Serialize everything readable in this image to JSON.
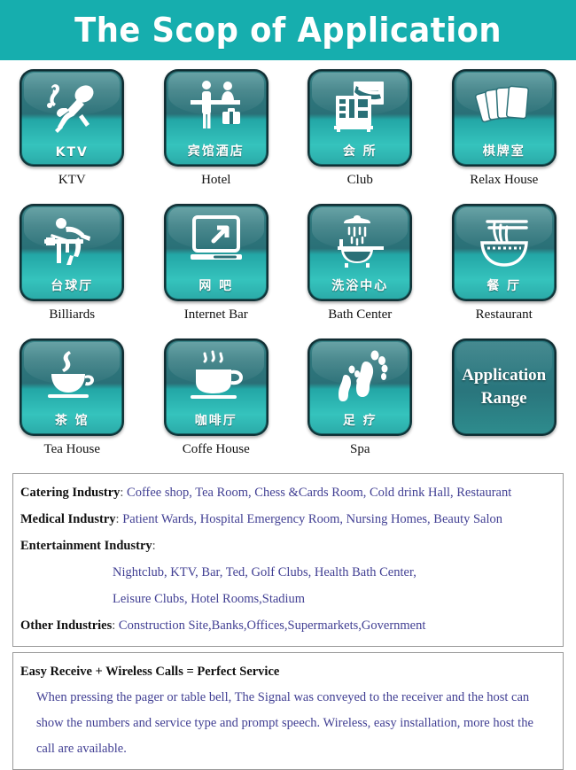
{
  "header": {
    "title": "The Scop of Application",
    "background_color": "#16aeae",
    "text_color": "#ffffff"
  },
  "grid": {
    "tiles": [
      {
        "caption": "KTV",
        "cn": "KTV",
        "icon": "karaoke-microphone-icon",
        "type": "icon"
      },
      {
        "caption": "Hotel",
        "cn": "宾馆酒店",
        "icon": "hotel-reception-icon",
        "type": "icon"
      },
      {
        "caption": "Club",
        "cn": "会 所",
        "icon": "club-building-icon",
        "type": "icon"
      },
      {
        "caption": "Relax House",
        "cn": "棋牌室",
        "icon": "playing-cards-icon",
        "type": "icon"
      },
      {
        "caption": "Billiards",
        "cn": "台球厅",
        "icon": "billiards-player-icon",
        "type": "icon"
      },
      {
        "caption": "Internet Bar",
        "cn": "网 吧",
        "icon": "computer-monitor-icon",
        "type": "icon"
      },
      {
        "caption": "Bath Center",
        "cn": "洗浴中心",
        "icon": "shower-bathtub-icon",
        "type": "icon"
      },
      {
        "caption": "Restaurant",
        "cn": "餐 厅",
        "icon": "noodle-bowl-icon",
        "type": "icon"
      },
      {
        "caption": "Tea House",
        "cn": "茶 馆",
        "icon": "tea-cup-icon",
        "type": "icon"
      },
      {
        "caption": "Coffe House",
        "cn": "咖啡厅",
        "icon": "coffee-cup-icon",
        "type": "icon"
      },
      {
        "caption": "Spa",
        "cn": "足 疗",
        "icon": "footprints-icon",
        "type": "icon"
      },
      {
        "caption": "",
        "cn": "",
        "icon": "",
        "type": "text",
        "big_label_line1": "Application",
        "big_label_line2": "Range"
      }
    ]
  },
  "industries": {
    "rows": [
      {
        "label": "Catering Industry",
        "colon": ":",
        "value": "Coffee shop, Tea Room, Chess &Cards Room, Cold drink Hall, Restaurant"
      },
      {
        "label": "Medical Industry",
        "colon": ":",
        "value": "Patient Wards, Hospital Emergency Room, Nursing Homes, Beauty Salon"
      },
      {
        "label": "Entertainment Industry",
        "colon": ":",
        "value": ""
      }
    ],
    "entertainment_lines": [
      "Nightclub, KTV, Bar, Ted, Golf Clubs, Health Bath Center,",
      "Leisure Clubs, Hotel Rooms,Stadium"
    ],
    "other_row": {
      "label": "Other Industries",
      "colon": ":",
      "value": "Construction Site,Banks,Offices,Supermarkets,Government"
    },
    "value_color": "#413f93"
  },
  "service": {
    "headline": "Easy Receive + Wireless Calls = Perfect Service",
    "body": "When pressing the pager or table bell, The Signal was conveyed to the receiver and the host can show the numbers and service type and prompt speech. Wireless, easy installation, more host the call  are available."
  }
}
